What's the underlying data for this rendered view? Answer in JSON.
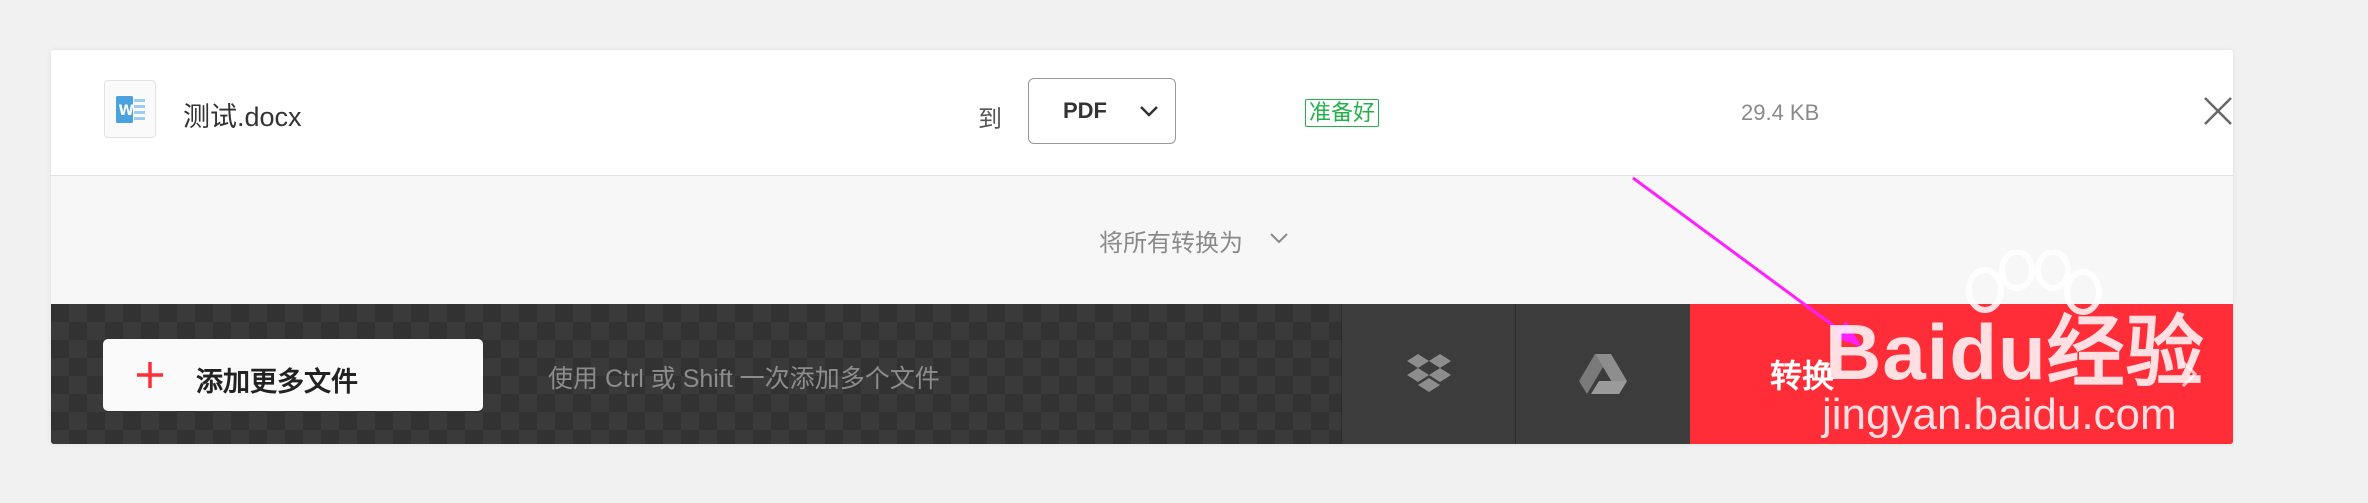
{
  "file": {
    "name": "测试.docx",
    "to_label": "到",
    "format": "PDF",
    "status": "准备好",
    "size": "29.4 KB"
  },
  "convert_all": {
    "label": "将所有转换为"
  },
  "actions": {
    "add_files_label": "添加更多文件",
    "hint": "使用 Ctrl 或 Shift 一次添加多个文件",
    "convert_label": "转换"
  },
  "watermark": {
    "main": "Baidu经验",
    "sub": "jingyan.baidu.com"
  },
  "icons": {
    "file_type": "word-doc-icon",
    "format_dropdown": "chevron-down-icon",
    "close": "close-icon",
    "convert_all_dropdown": "chevron-down-icon",
    "add": "plus-icon",
    "dropbox": "dropbox-icon",
    "google_drive": "google-drive-icon",
    "convert_arrow": "chevron-right-icon"
  },
  "colors": {
    "accent": "#ff2d38",
    "status_green": "#24b14b",
    "word_blue": "#4aa3df",
    "annotation_arrow": "#ff1fff"
  }
}
